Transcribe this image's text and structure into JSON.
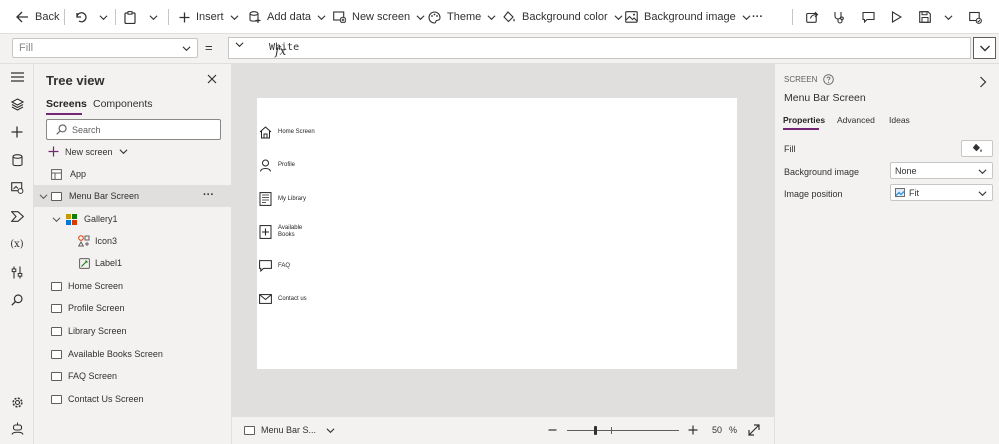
{
  "toolbar": {
    "back": "Back",
    "insert": "Insert",
    "add_data": "Add data",
    "new_screen": "New screen",
    "theme": "Theme",
    "background_color": "Background color",
    "background_image": "Background image",
    "more": "···"
  },
  "formula_bar": {
    "property": "Fill",
    "equals": "=",
    "fx": "fx",
    "formula": "White"
  },
  "tree_view": {
    "title": "Tree view",
    "tabs": [
      "Screens",
      "Components"
    ],
    "search_placeholder": "Search",
    "new_screen": "New screen",
    "items": [
      "App",
      "Menu Bar Screen",
      "Gallery1",
      "Icon3",
      "Label1",
      "Home Screen",
      "Profile Screen",
      "Library Screen",
      "Available Books Screen",
      "FAQ Screen",
      "Contact Us Screen"
    ],
    "selected_more": "···"
  },
  "canvas": {
    "menu": [
      "Home Screen",
      "Profile",
      "My Library",
      "Available Books",
      "FAQ",
      "Contact us"
    ],
    "menu_icons": [
      "home-icon",
      "person-icon",
      "library-icon",
      "add-book-icon",
      "chat-icon",
      "mail-icon"
    ]
  },
  "status_bar": {
    "screen_name": "Menu Bar S...",
    "zoom_value": "50",
    "zoom_unit": "%",
    "zoom_fraction": 0.5
  },
  "properties": {
    "section": "SCREEN",
    "screen_name": "Menu Bar Screen",
    "tabs": [
      "Properties",
      "Advanced",
      "Ideas"
    ],
    "fill_label": "Fill",
    "background_image_label": "Background image",
    "background_image_value": "None",
    "image_position_label": "Image position",
    "image_position_value": "Fit"
  },
  "colors": {
    "accent": "#742774",
    "panel": "#f3f2f1",
    "canvas_bg": "#e1dfdd"
  }
}
